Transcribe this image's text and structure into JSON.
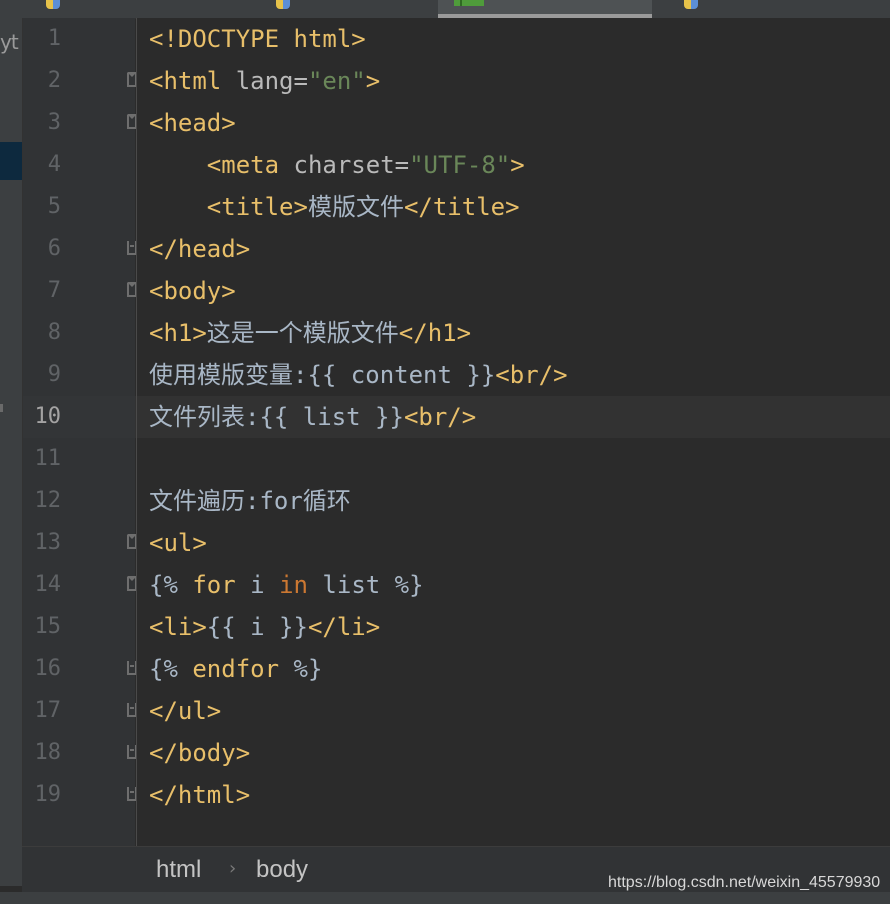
{
  "sidebar": {
    "label": "yt"
  },
  "editor": {
    "current_line": 10,
    "lines": [
      {
        "n": "1",
        "fold": "",
        "parts": [
          [
            "tag",
            "<!DOCTYPE html>"
          ]
        ]
      },
      {
        "n": "2",
        "fold": "open",
        "parts": [
          [
            "tag",
            "<html "
          ],
          [
            "attr",
            "lang="
          ],
          [
            "str",
            "\"en\""
          ],
          [
            "tag",
            ">"
          ]
        ]
      },
      {
        "n": "3",
        "fold": "open",
        "parts": [
          [
            "tag",
            "<head>"
          ]
        ]
      },
      {
        "n": "4",
        "fold": "",
        "parts": [
          [
            "txt",
            "    "
          ],
          [
            "tag",
            "<meta "
          ],
          [
            "attr",
            "charset="
          ],
          [
            "str",
            "\"UTF-8\""
          ],
          [
            "tag",
            ">"
          ]
        ]
      },
      {
        "n": "5",
        "fold": "",
        "parts": [
          [
            "txt",
            "    "
          ],
          [
            "tag",
            "<title>"
          ],
          [
            "cn",
            "模版文件"
          ],
          [
            "tag",
            "</title>"
          ]
        ]
      },
      {
        "n": "6",
        "fold": "close",
        "parts": [
          [
            "tag",
            "</head>"
          ]
        ]
      },
      {
        "n": "7",
        "fold": "open",
        "parts": [
          [
            "tag",
            "<body>"
          ]
        ]
      },
      {
        "n": "8",
        "fold": "",
        "parts": [
          [
            "tag",
            "<h1>"
          ],
          [
            "cn",
            "这是一个模版文件"
          ],
          [
            "tag",
            "</h1>"
          ]
        ]
      },
      {
        "n": "9",
        "fold": "",
        "parts": [
          [
            "cn",
            "使用模版变量"
          ],
          [
            "txt",
            ":{{ content }}"
          ],
          [
            "tag",
            "<br/>"
          ]
        ]
      },
      {
        "n": "10",
        "fold": "",
        "parts": [
          [
            "cn",
            "文件列表"
          ],
          [
            "txt",
            ":{{ list }}"
          ],
          [
            "tag",
            "<br/>"
          ]
        ]
      },
      {
        "n": "11",
        "fold": "",
        "parts": []
      },
      {
        "n": "12",
        "fold": "",
        "parts": [
          [
            "cn",
            "文件遍历"
          ],
          [
            "txt",
            ":for"
          ],
          [
            "cn",
            "循环"
          ]
        ]
      },
      {
        "n": "13",
        "fold": "open",
        "parts": [
          [
            "tag",
            "<ul>"
          ]
        ]
      },
      {
        "n": "14",
        "fold": "open",
        "parts": [
          [
            "txt",
            "{% "
          ],
          [
            "tag",
            "for "
          ],
          [
            "txt",
            "i "
          ],
          [
            "kw",
            "in "
          ],
          [
            "txt",
            "list %}"
          ]
        ]
      },
      {
        "n": "15",
        "fold": "",
        "parts": [
          [
            "tag",
            "<li>"
          ],
          [
            "txt",
            "{{ i }}"
          ],
          [
            "tag",
            "</li>"
          ]
        ]
      },
      {
        "n": "16",
        "fold": "close",
        "parts": [
          [
            "txt",
            "{% "
          ],
          [
            "tag",
            "endfor "
          ],
          [
            "txt",
            "%}"
          ]
        ]
      },
      {
        "n": "17",
        "fold": "close",
        "parts": [
          [
            "tag",
            "</ul>"
          ]
        ]
      },
      {
        "n": "18",
        "fold": "close",
        "parts": [
          [
            "tag",
            "</body>"
          ]
        ]
      },
      {
        "n": "19",
        "fold": "close",
        "parts": [
          [
            "tag",
            "</html>"
          ]
        ]
      }
    ]
  },
  "breadcrumb": {
    "items": [
      "html",
      "body"
    ],
    "separator": "›"
  },
  "watermark": "https://blog.csdn.net/weixin_45579930",
  "colors": {
    "tag": "#e8bf6a",
    "attr": "#bababa",
    "string": "#6a8759",
    "text": "#a9b7c6",
    "keyword": "#cc7832",
    "background": "#2b2b2b"
  }
}
